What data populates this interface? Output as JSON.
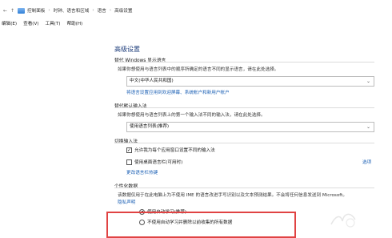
{
  "address": {
    "back_glyph": "←",
    "up_glyph": "↑",
    "crumbs": [
      "控制面板",
      "时钟、语言和区域",
      "语言",
      "高级设置"
    ],
    "separator": "›"
  },
  "menu": [
    "编辑(E)",
    "查看(V)",
    "工具(T)",
    "帮助(H)"
  ],
  "page": {
    "title": "高级设置",
    "display_lang": {
      "title": "替代 Windows 显示语言",
      "desc": "如果你想使用与语言列表中的顺序所确定的语言不同的显示语言，请在此处选择。",
      "selected": "中文(中华人民共和国)",
      "link": "将语言设置应用到欢迎屏幕、系统帐户和新用户帐户"
    },
    "input_method": {
      "title": "替代默认输入法",
      "desc": "如果你想使用与语言列表上的第一个输入法不同的输入法，请在此处选择。",
      "selected": "使用语言列表(推荐)"
    },
    "switch": {
      "title": "切换输入法",
      "opt1": "允许我为每个应用窗口设置不同的输入法",
      "opt1_checked": "✓",
      "opt2": "使用桌面语言栏(可用时)",
      "options_link": "选项",
      "hotkey_link": "更改语言栏热键"
    },
    "personal": {
      "title": "个性化数据",
      "desc": "该数据仅用于在此电脑上为不使用 IME 的语言改进手写识别以及文本预测结果。不会将任何信息发送到 Microsoft。",
      "privacy_link": "隐私声明",
      "radio1": "使用自动学习(推荐)",
      "radio2": "不使用自动学习并删除以前收集的所有数据"
    }
  }
}
